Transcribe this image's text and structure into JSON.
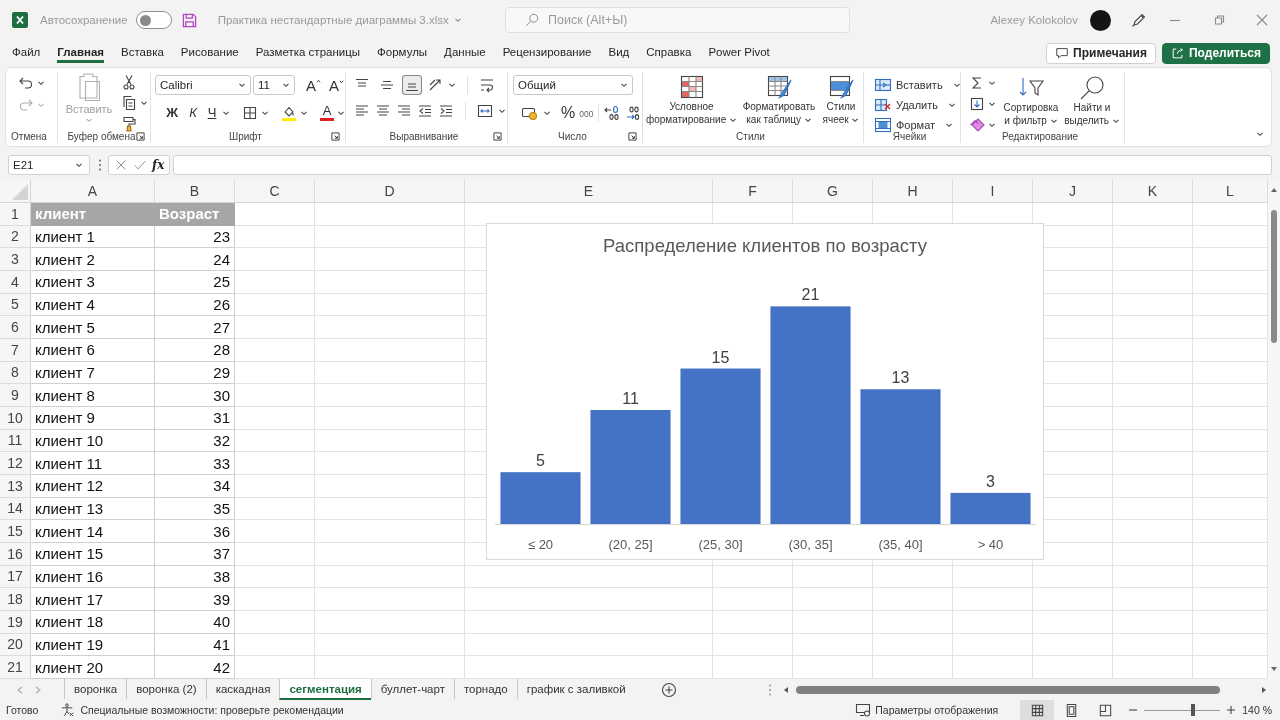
{
  "title_bar": {
    "autosave_label": "Автосохранение",
    "autosave_on": false,
    "file_name": "Практика нестандартные диаграммы 3.xlsx",
    "search_placeholder": "Поиск (Alt+Ы)",
    "user_name": "Alexey Kolokolov"
  },
  "menu_tabs": [
    {
      "label": "Файл",
      "selected": false
    },
    {
      "label": "Главная",
      "selected": true
    },
    {
      "label": "Вставка",
      "selected": false
    },
    {
      "label": "Рисование",
      "selected": false
    },
    {
      "label": "Разметка страницы",
      "selected": false
    },
    {
      "label": "Формулы",
      "selected": false
    },
    {
      "label": "Данные",
      "selected": false
    },
    {
      "label": "Рецензирование",
      "selected": false
    },
    {
      "label": "Вид",
      "selected": false
    },
    {
      "label": "Справка",
      "selected": false
    },
    {
      "label": "Power Pivot",
      "selected": false
    }
  ],
  "comments_button": "Примечания",
  "share_button": "Поделиться",
  "ribbon": {
    "undo": {
      "label": "Отмена",
      "redo_disabled": true
    },
    "clipboard": {
      "label": "Буфер обмена",
      "paste_label": "Вставить",
      "paste_disabled": true
    },
    "font": {
      "label": "Шрифт",
      "font_name": "Calibri",
      "font_size": "11",
      "grow": "A",
      "shrink": "A",
      "bold": "Ж",
      "italic": "К",
      "underline": "Ч",
      "font_color": "A"
    },
    "alignment": {
      "label": "Выравнивание",
      "vertical": [
        {
          "kind": "top",
          "selected": false
        },
        {
          "kind": "middle",
          "selected": false
        },
        {
          "kind": "bottom",
          "selected": true
        }
      ]
    },
    "number": {
      "label": "Число",
      "format": "Общий",
      "percent": "%",
      "thousands": "000"
    },
    "styles": {
      "label": "Стили",
      "buttons": [
        {
          "kind": "conditional",
          "label": "Условное форматирование"
        },
        {
          "kind": "table",
          "label": "Форматировать как таблицу"
        },
        {
          "kind": "cell_styles",
          "label": "Стили ячеек"
        }
      ]
    },
    "cells": {
      "label": "Ячейки",
      "buttons": [
        {
          "kind": "insert",
          "label": "Вставить"
        },
        {
          "kind": "delete",
          "label": "Удалить"
        },
        {
          "kind": "format",
          "label": "Формат"
        }
      ]
    },
    "editing": {
      "label": "Редактирование",
      "buttons": [
        {
          "kind": "sort",
          "label": "Сортировка и фильтр"
        },
        {
          "kind": "find",
          "label": "Найти и выделить"
        }
      ]
    }
  },
  "formula_bar": {
    "name_box": "E21",
    "fx": "fx"
  },
  "sheet": {
    "columns": [
      "A",
      "B",
      "C",
      "D",
      "E",
      "F",
      "G",
      "H",
      "I",
      "J",
      "K",
      "L"
    ],
    "row_numbers": [
      "1",
      "2",
      "3",
      "4",
      "5",
      "6",
      "7",
      "8",
      "9",
      "10",
      "11",
      "12",
      "13",
      "14",
      "15",
      "16",
      "17",
      "18",
      "19",
      "20",
      "21"
    ],
    "table_header": [
      "клиент",
      "Возраст"
    ],
    "table_rows": [
      [
        "клиент 1",
        "23"
      ],
      [
        "клиент 2",
        "24"
      ],
      [
        "клиент 3",
        "25"
      ],
      [
        "клиент 4",
        "26"
      ],
      [
        "клиент 5",
        "27"
      ],
      [
        "клиент 6",
        "28"
      ],
      [
        "клиент 7",
        "29"
      ],
      [
        "клиент 8",
        "30"
      ],
      [
        "клиент 9",
        "31"
      ],
      [
        "клиент 10",
        "32"
      ],
      [
        "клиент 11",
        "33"
      ],
      [
        "клиент 12",
        "34"
      ],
      [
        "клиент 13",
        "35"
      ],
      [
        "клиент 14",
        "36"
      ],
      [
        "клиент 15",
        "37"
      ],
      [
        "клиент 16",
        "38"
      ],
      [
        "клиент 17",
        "39"
      ],
      [
        "клиент 18",
        "40"
      ],
      [
        "клиент 19",
        "41"
      ],
      [
        "клиент 20",
        "42"
      ]
    ]
  },
  "chart": {
    "chart_data": {
      "type": "bar",
      "title": "Распределение клиентов по возрасту",
      "categories": [
        "≤ 20",
        "(20, 25]",
        "(25, 30]",
        "(30, 35]",
        "(35, 40]",
        "> 40"
      ],
      "values": [
        5,
        11,
        15,
        21,
        13,
        3
      ],
      "data_labels": true
    }
  },
  "sheet_tabs": [
    {
      "label": "воронка",
      "selected": false
    },
    {
      "label": "воронка (2)",
      "selected": false
    },
    {
      "label": "каскадная",
      "selected": false
    },
    {
      "label": "сегментация",
      "selected": true
    },
    {
      "label": "буллет-чарт",
      "selected": false
    },
    {
      "label": "торнадо",
      "selected": false
    },
    {
      "label": "график с заливкой",
      "selected": false
    }
  ],
  "status_bar": {
    "ready": "Готово",
    "accessibility": "Специальные возможности: проверьте рекомендации",
    "display_settings": "Параметры отображения",
    "views": [
      {
        "kind": "normal",
        "selected": true
      },
      {
        "kind": "page_layout",
        "selected": false
      },
      {
        "kind": "page_break",
        "selected": false
      }
    ],
    "zoom": {
      "level": 0.64,
      "reading": "140 %"
    }
  }
}
